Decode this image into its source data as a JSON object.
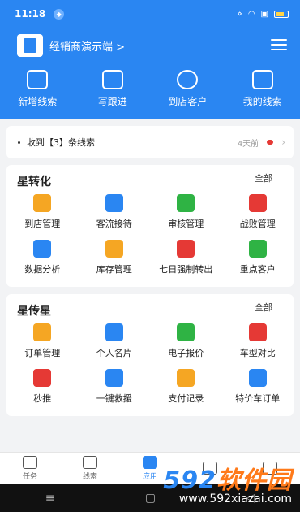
{
  "status": {
    "time": "11:18"
  },
  "header": {
    "org_name": "经销商演示端 >",
    "quick_actions": [
      {
        "label": "新增线索",
        "icon": "add-lead-icon"
      },
      {
        "label": "写跟进",
        "icon": "edit-followup-icon"
      },
      {
        "label": "到店客户",
        "icon": "store-customers-icon"
      },
      {
        "label": "我的线索",
        "icon": "my-leads-icon"
      }
    ]
  },
  "notice": {
    "text": "收到【3】条线索",
    "time": "4天前"
  },
  "section1": {
    "title": "星转化",
    "all_label": "全部",
    "items": [
      {
        "label": "到店管理",
        "icon": "store-manage-icon",
        "color": "#f5a623"
      },
      {
        "label": "客流接待",
        "icon": "reception-icon",
        "color": "#2a86f2"
      },
      {
        "label": "审核管理",
        "icon": "audit-icon",
        "color": "#2fb344"
      },
      {
        "label": "战败管理",
        "icon": "defeat-icon",
        "color": "#e53935"
      },
      {
        "label": "数据分析",
        "icon": "analytics-icon",
        "color": "#2a86f2"
      },
      {
        "label": "库存管理",
        "icon": "inventory-icon",
        "color": "#f5a623"
      },
      {
        "label": "七日强制转出",
        "icon": "alarm-icon",
        "color": "#e53935"
      },
      {
        "label": "重点客户",
        "icon": "key-customer-icon",
        "color": "#2fb344"
      }
    ]
  },
  "section2": {
    "title": "星传星",
    "all_label": "全部",
    "items": [
      {
        "label": "订单管理",
        "icon": "order-icon",
        "color": "#f5a623"
      },
      {
        "label": "个人名片",
        "icon": "card-icon",
        "color": "#2a86f2"
      },
      {
        "label": "电子报价",
        "icon": "quote-icon",
        "color": "#2fb344"
      },
      {
        "label": "车型对比",
        "icon": "car-compare-icon",
        "color": "#e53935"
      },
      {
        "label": "秒推",
        "icon": "push-icon",
        "color": "#e53935"
      },
      {
        "label": "一键救援",
        "icon": "rescue-icon",
        "color": "#2a86f2"
      },
      {
        "label": "支付记录",
        "icon": "payment-icon",
        "color": "#f5a623"
      },
      {
        "label": "特价车订单",
        "icon": "discount-icon",
        "color": "#2a86f2"
      }
    ]
  },
  "tabbar": [
    {
      "label": "任务",
      "icon": "task-icon",
      "active": false
    },
    {
      "label": "线索",
      "icon": "leads-icon",
      "active": false
    },
    {
      "label": "应用",
      "icon": "apps-icon",
      "active": true
    },
    {
      "label": "",
      "icon": "stats-icon",
      "active": false
    },
    {
      "label": "",
      "icon": "profile-icon",
      "active": false
    }
  ],
  "watermark": {
    "big_a": "592",
    "big_b": "软件园",
    "small": "www.592xiazai.com"
  }
}
